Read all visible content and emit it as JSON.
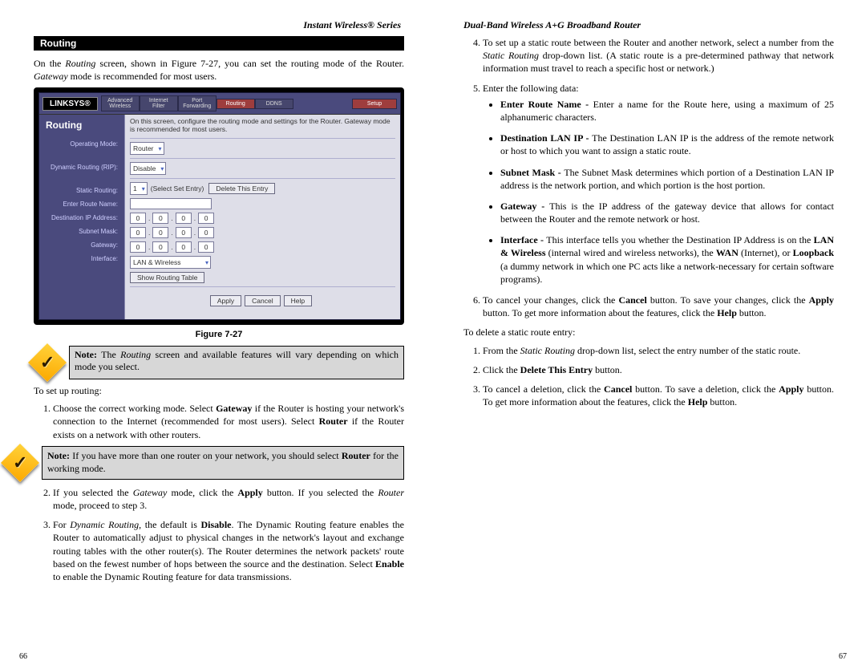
{
  "page_left": {
    "header": "Instant Wireless® Series",
    "bar_title": "Routing",
    "intro_1": "On the ",
    "intro_em1": "Routing",
    "intro_2": " screen, shown in Figure 7-27, you can set the routing mode of the Router. ",
    "intro_em2": "Gateway",
    "intro_3": " mode is recommended for most users.",
    "figure_caption": "Figure 7-27",
    "note1_prefix": "Note:",
    "note1_body": " The Routing screen and available features will vary depending on which mode you select.",
    "setup_intro": "To set up routing:",
    "step1_a": "Choose the correct working mode. Select ",
    "step1_b": "Gateway",
    "step1_c": " if the Router is hosting your network's connection to the Internet (recommended for most users). Select ",
    "step1_d": "Router",
    "step1_e": " if the Router exists on a network with other routers.",
    "note2_prefix": "Note:",
    "note2_body": " If you have more than one router on your network, you should select Router for the working mode.",
    "step2_a": "If you selected the ",
    "step2_b": "Gateway",
    "step2_c": " mode, click the ",
    "step2_d": "Apply",
    "step2_e": " button. If you selected the ",
    "step2_f": "Router",
    "step2_g": " mode, proceed to step 3.",
    "step3_a": "For ",
    "step3_b": "Dynamic Routing",
    "step3_c": ", the default is ",
    "step3_d": "Disable",
    "step3_e": ". The Dynamic Routing feature enables the Router to automatically adjust to physical changes in the network's layout and exchange routing tables with the other router(s). The Router determines the network packets' route based on the fewest number of hops between the source and the destination. Select ",
    "step3_f": "Enable",
    "step3_g": " to enable the Dynamic Routing feature for data transmissions.",
    "page_number": "66"
  },
  "page_right": {
    "header": "Dual-Band Wireless A+G Broadband Router",
    "step4_a": "To set up a static route between the Router and another network, select a number from the ",
    "step4_b": "Static Routing",
    "step4_c": " drop-down list. (A static route is a pre-determined pathway that network information must travel to reach a specific host or network.)",
    "step5_a": "Enter the following data:",
    "b1_t": "Enter Route Name - ",
    "b1_b": "Enter a name for the Route here, using a maximum of 25 alphanumeric characters.",
    "b2_t": "Destination LAN IP - ",
    "b2_b": "The Destination LAN IP is the address of the remote network or host to which you want to assign a static route.",
    "b3_t": "Subnet Mask - ",
    "b3_b": "The Subnet Mask determines which portion of a Destination LAN IP address is the network portion, and which portion is the host portion.",
    "b4_t": "Gateway - ",
    "b4_b": "This is the IP address of the gateway device that allows for contact between the Router and the remote network or host.",
    "b5_t": "Interface - ",
    "b5_b1": "This interface tells you whether the Destination IP Address is on the ",
    "b5_b2": "LAN & Wireless",
    "b5_b3": " (internal wired and wireless networks), the ",
    "b5_b4": "WAN",
    "b5_b5": " (Internet), or ",
    "b5_b6": "Loopback",
    "b5_b7": " (a dummy network in which one PC acts like a network-necessary for certain software programs).",
    "step6_a": "To cancel your changes, click the ",
    "step6_b": "Cancel",
    "step6_c": " button. To save your changes, click the ",
    "step6_d": "Apply",
    "step6_e": " button. To get more information about the features, click the ",
    "step6_f": "Help",
    "step6_g": " button.",
    "delete_intro": "To delete a static route entry:",
    "d1_a": "From the ",
    "d1_b": "Static Routing",
    "d1_c": " drop-down list, select the entry number of the static route.",
    "d2_a": "Click the ",
    "d2_b": "Delete This Entry",
    "d2_c": " button.",
    "d3_a": "To cancel a deletion, click the ",
    "d3_b": "Cancel",
    "d3_c": " button. To save a deletion, click the ",
    "d3_d": "Apply",
    "d3_e": " button. To get more information about the features, click the ",
    "d3_f": "Help",
    "d3_g": " button.",
    "page_number": "67"
  },
  "screenshot": {
    "brand": "LINKSYS®",
    "tabs": {
      "t1a": "Advanced",
      "t1b": "Wireless",
      "t2a": "Internet",
      "t2b": "Filter",
      "t3a": "Port",
      "t3b": "Forwarding",
      "t4": "Routing",
      "t5": "DDNS",
      "setup": "Setup"
    },
    "side_title": "Routing",
    "desc": "On this screen, configure the routing mode and settings for the Router. Gateway mode is recommended for most users.",
    "labels": {
      "op": "Operating Mode:",
      "dyn": "Dynamic Routing (RIP):",
      "stat": "Static Routing:",
      "rname": "Enter Route Name:",
      "dip": "Destination IP Address:",
      "mask": "Subnet Mask:",
      "gw": "Gateway:",
      "iface": "Interface:"
    },
    "values": {
      "op": "Router",
      "dyn": "Disable",
      "stat": "1",
      "select_hint": "(Select Set Entry)",
      "del_btn": "Delete This Entry",
      "iface": "LAN & Wireless",
      "show_table": "Show Routing Table",
      "ip0": "0",
      "apply": "Apply",
      "cancel": "Cancel",
      "help": "Help"
    }
  }
}
